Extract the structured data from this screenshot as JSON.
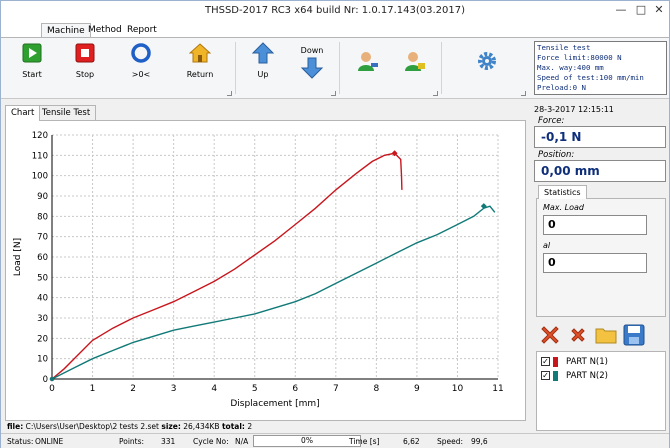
{
  "app": {
    "title": "THSSD-2017 RC3 x64 build Nr: 1.0.17.143(03.2017)"
  },
  "ribbon_tabs": [
    "Machine",
    "Method",
    "Report"
  ],
  "toolbar": {
    "start": "Start",
    "stop": "Stop",
    "zero": ">0<",
    "return": "Return",
    "up": "Up",
    "down": "Down"
  },
  "info_lines": [
    "Tensile test",
    "Force limit:80000 N",
    "Max. way:400 mm",
    "Speed of test:100 mm/min",
    "Preload:0 N"
  ],
  "chart_tabs": [
    "Chart",
    "Tensile Test"
  ],
  "readout": {
    "datetime": "28-3-2017 12:15:11",
    "force_label": "Force:",
    "force_value": "-0,1 N",
    "position_label": "Position:",
    "position_value": "0,00 mm"
  },
  "statistics": {
    "tab": "Statistics",
    "max_load_label": "Max. Load",
    "max_load_value": "0",
    "al_label": "al",
    "al_value": "0"
  },
  "legend": [
    {
      "label": "PART N(1)",
      "color": "#c8161d",
      "checked": "✓"
    },
    {
      "label": "PART N(2)",
      "color": "#117a78",
      "checked": "✓"
    }
  ],
  "file_info": {
    "file_label": "file:",
    "file_path": "C:\\Users\\User\\Desktop\\2 tests 2.set",
    "size_label": "size:",
    "size_value": "26,434KB",
    "total_label": "total:",
    "total_value": "2"
  },
  "status": {
    "status_label": "Status:",
    "status_value": "ONLINE",
    "points_label": "Points:",
    "points_value": "331",
    "cycle_label": "Cycle No:",
    "cycle_value": "N/A",
    "progress": "0%",
    "time_label": "Time [s]",
    "time_value": "6,62",
    "speed_label": "Speed:",
    "speed_value": "99,6"
  },
  "chart_data": {
    "type": "line",
    "xlabel": "Displacement [mm]",
    "ylabel": "Load [N]",
    "xlim": [
      0,
      11
    ],
    "ylim": [
      0,
      120
    ],
    "xticks": [
      0,
      1,
      2,
      3,
      4,
      5,
      6,
      7,
      8,
      9,
      10,
      11
    ],
    "yticks": [
      0,
      10,
      20,
      30,
      40,
      50,
      60,
      70,
      80,
      90,
      100,
      110,
      120
    ],
    "grid": true,
    "series": [
      {
        "name": "PART N(1)",
        "color": "#c8161d",
        "x": [
          0,
          0.3,
          0.6,
          1.0,
          1.5,
          2.0,
          2.5,
          3.0,
          3.5,
          4.0,
          4.5,
          5.0,
          5.5,
          6.0,
          6.5,
          7.0,
          7.5,
          7.9,
          8.2,
          8.45,
          8.6,
          8.62,
          8.63
        ],
        "y": [
          0,
          5,
          11,
          19,
          25,
          30,
          34,
          38,
          43,
          48,
          54,
          61,
          68,
          76,
          84,
          93,
          101,
          107,
          110,
          111,
          108,
          100,
          93
        ]
      },
      {
        "name": "PART N(2)",
        "color": "#117a78",
        "x": [
          0,
          0.5,
          1.0,
          1.5,
          2.0,
          2.5,
          3.0,
          3.5,
          4.0,
          4.5,
          5.0,
          5.5,
          6.0,
          6.5,
          7.0,
          7.5,
          8.0,
          8.5,
          9.0,
          9.5,
          10.0,
          10.4,
          10.65,
          10.8,
          10.92
        ],
        "y": [
          0,
          5,
          10,
          14,
          18,
          21,
          24,
          26,
          28,
          30,
          32,
          35,
          38,
          42,
          47,
          52,
          57,
          62,
          67,
          71,
          76,
          80,
          84,
          85,
          82
        ]
      }
    ],
    "max_markers": [
      {
        "series": "PART N(1)",
        "x": 8.45,
        "y": 111
      },
      {
        "series": "PART N(2)",
        "x": 10.65,
        "y": 85
      }
    ]
  }
}
